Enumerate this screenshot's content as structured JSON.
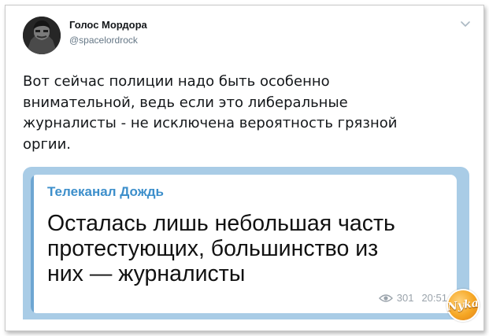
{
  "author": {
    "name": "Голос Мордора",
    "handle": "@spacelordrock"
  },
  "tweet": {
    "text": "Вот сейчас полиции надо быть особенно\nвнимательной, ведь если это либеральные\nжурналисты - не исключена вероятность грязной\nоргии."
  },
  "embed": {
    "channel": "Телеканал Дождь",
    "text": "Осталась лишь небольшая часть\nпротестующих, большинство из\nних — журналисты",
    "views": "301",
    "time": "20:51"
  },
  "watermark": "Nyka",
  "colors": {
    "embed_background": "#a9cce6",
    "channel_accent": "#3d8fcb",
    "bubble_bar": "#6ea6d2",
    "handle_gray": "#657786",
    "stamp_orange": "#f5a623"
  },
  "icons": [
    "caret-down-icon",
    "eye-icon"
  ]
}
